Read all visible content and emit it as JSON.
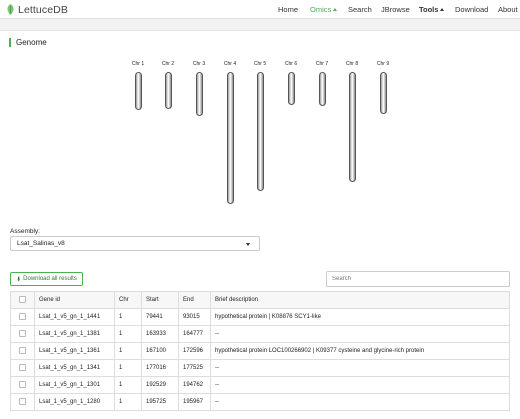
{
  "brand": {
    "name": "LettuceDB",
    "color": "#4caf50"
  },
  "nav": {
    "items": [
      {
        "label": "Home",
        "caret": false,
        "active": false
      },
      {
        "label": "Omics",
        "caret": true,
        "active": true
      },
      {
        "label": "Search",
        "caret": false,
        "active": false
      },
      {
        "label": "JBrowse",
        "caret": false,
        "active": false
      },
      {
        "label": "Tools",
        "caret": true,
        "active": false
      },
      {
        "label": "Download",
        "caret": false,
        "active": false
      },
      {
        "label": "About",
        "caret": false,
        "active": false
      }
    ]
  },
  "genome": {
    "title": "Genome",
    "chromosomes": [
      {
        "label": "Chr 1",
        "relative_length": 0.286
      },
      {
        "label": "Chr 2",
        "relative_length": 0.283
      },
      {
        "label": "Chr 3",
        "relative_length": 0.336
      },
      {
        "label": "Chr 4",
        "relative_length": 1.0
      },
      {
        "label": "Chr 5",
        "relative_length": 0.902
      },
      {
        "label": "Chr 6",
        "relative_length": 0.252
      },
      {
        "label": "Chr 7",
        "relative_length": 0.255
      },
      {
        "label": "Chr 8",
        "relative_length": 0.832
      },
      {
        "label": "Chr 9",
        "relative_length": 0.315
      }
    ]
  },
  "assembly": {
    "label": "Assembly:",
    "selected": "Lsat_Salinas_v8"
  },
  "download_button": {
    "label": "Download all results",
    "icon": "download-icon"
  },
  "search": {
    "placeholder": "Search"
  },
  "table": {
    "headers": [
      "Gene id",
      "Chr",
      "Start",
      "End",
      "Brief description"
    ],
    "rows": [
      [
        "Lsat_1_v5_gn_1_1441",
        "1",
        "79441",
        "93015",
        "hypothetical protein | K08876 SCY1-like"
      ],
      [
        "Lsat_1_v5_gn_1_1381",
        "1",
        "163933",
        "164777",
        "--"
      ],
      [
        "Lsat_1_v5_gn_1_1361",
        "1",
        "167100",
        "172596",
        "hypothetical protein LOC100266902 | K09377 cysteine and glycine-rich protein"
      ],
      [
        "Lsat_1_v5_gn_1_1341",
        "1",
        "177016",
        "177525",
        "--"
      ],
      [
        "Lsat_1_v5_gn_1_1301",
        "1",
        "192529",
        "194762",
        "--"
      ],
      [
        "Lsat_1_v5_gn_1_1280",
        "1",
        "195725",
        "195967",
        "--"
      ]
    ]
  }
}
